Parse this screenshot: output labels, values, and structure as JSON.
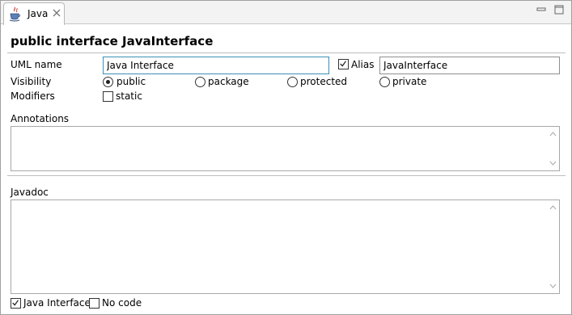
{
  "tab": {
    "label": "Java"
  },
  "header": {
    "title": "public interface JavaInterface"
  },
  "uml_name": {
    "label": "UML name",
    "value": "Java Interface"
  },
  "alias": {
    "label": "Alias",
    "checked": true,
    "value": "JavaInterface"
  },
  "visibility": {
    "label": "Visibility",
    "options": [
      "public",
      "package",
      "protected",
      "private"
    ],
    "selected": "public"
  },
  "modifiers": {
    "label": "Modifiers",
    "static_label": "static",
    "static_checked": false
  },
  "annotations": {
    "label": "Annotations",
    "value": ""
  },
  "javadoc": {
    "label": "Javadoc",
    "value": ""
  },
  "footer": {
    "java_interface_label": "Java Interface",
    "java_interface_checked": true,
    "no_code_label": "No code",
    "no_code_checked": false
  },
  "colors": {
    "focus_border": "#3c8fb8",
    "separator": "#bdbdbd"
  }
}
